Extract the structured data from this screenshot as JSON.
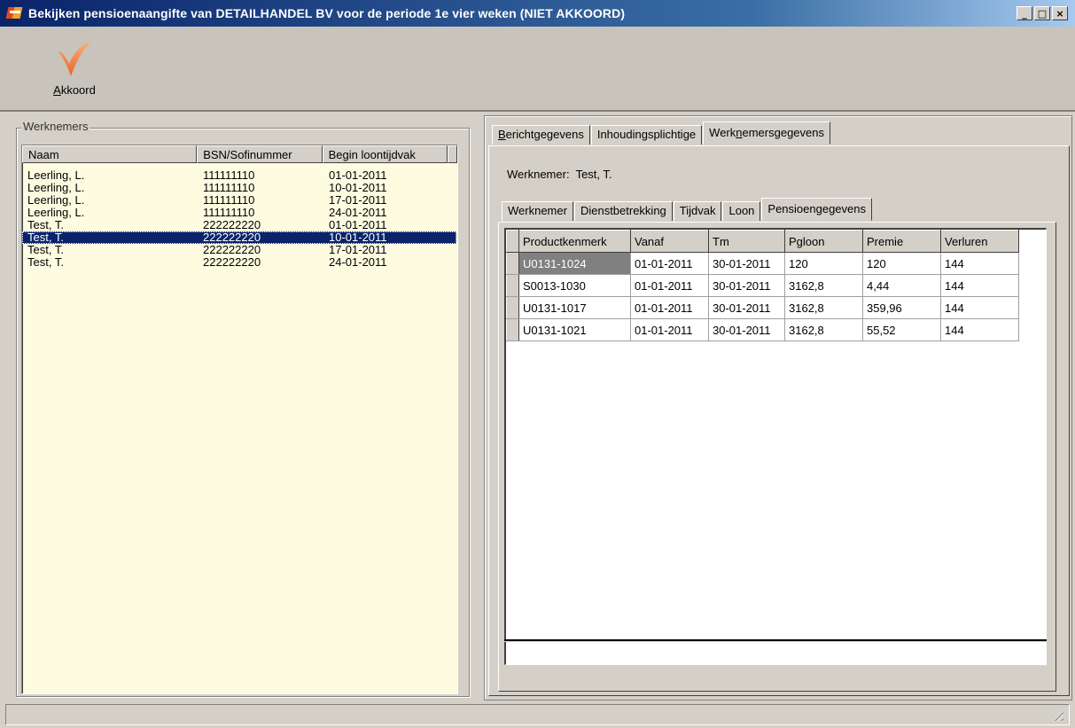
{
  "window": {
    "title": "Bekijken pensioenaangifte van DETAILHANDEL BV voor de periode 1e vier weken  (NIET AKKOORD)",
    "minimize": "_",
    "maximize": "□",
    "close": "×"
  },
  "toolbar": {
    "akkoord_accel": "A",
    "akkoord_rest": "kkoord"
  },
  "werknemers": {
    "group_title": "Werknemers",
    "columns": [
      "Naam",
      "BSN/Sofinummer",
      "Begin loontijdvak"
    ],
    "rows": [
      {
        "naam": "Leerling, L.",
        "bsn": "111111110",
        "begin": "01-01-2011"
      },
      {
        "naam": "Leerling, L.",
        "bsn": "111111110",
        "begin": "10-01-2011"
      },
      {
        "naam": "Leerling, L.",
        "bsn": "111111110",
        "begin": "17-01-2011"
      },
      {
        "naam": "Leerling, L.",
        "bsn": "111111110",
        "begin": "24-01-2011"
      },
      {
        "naam": "Test, T.",
        "bsn": "222222220",
        "begin": "01-01-2011"
      },
      {
        "naam": "Test, T.",
        "bsn": "222222220",
        "begin": "10-01-2011"
      },
      {
        "naam": "Test, T.",
        "bsn": "222222220",
        "begin": "17-01-2011"
      },
      {
        "naam": "Test, T.",
        "bsn": "222222220",
        "begin": "24-01-2011"
      }
    ],
    "selected_index": 5
  },
  "outer_tabs": {
    "tab1_accel": "B",
    "tab1_rest": "erichtgegevens",
    "tab2": "Inhoudingsplichtige",
    "tab3_pre": "Werk",
    "tab3_accel": "n",
    "tab3_post": "emersgegevens",
    "active": 2
  },
  "employee": {
    "label": "Werknemer:",
    "name": "Test, T."
  },
  "inner_tabs": {
    "items": [
      "Werknemer",
      "Dienstbetrekking",
      "Tijdvak",
      "Loon",
      "Pensioengegevens"
    ],
    "active": 4
  },
  "pension_grid": {
    "columns": [
      "Productkenmerk",
      "Vanaf",
      "Tm",
      "Pgloon",
      "Premie",
      "Verluren"
    ],
    "rows": [
      [
        "U0131-1024",
        "01-01-2011",
        "30-01-2011",
        "120",
        "120",
        "144"
      ],
      [
        "S0013-1030",
        "01-01-2011",
        "30-01-2011",
        "3162,8",
        "4,44",
        "144"
      ],
      [
        "U0131-1017",
        "01-01-2011",
        "30-01-2011",
        "3162,8",
        "359,96",
        "144"
      ],
      [
        "U0131-1021",
        "01-01-2011",
        "30-01-2011",
        "3162,8",
        "55,52",
        "144"
      ]
    ]
  },
  "colors": {
    "titlebar_start": "#0a246a",
    "selection": "#0a246a",
    "listview_bg": "#fdfbe0",
    "checkmark": "#f07a3a"
  }
}
